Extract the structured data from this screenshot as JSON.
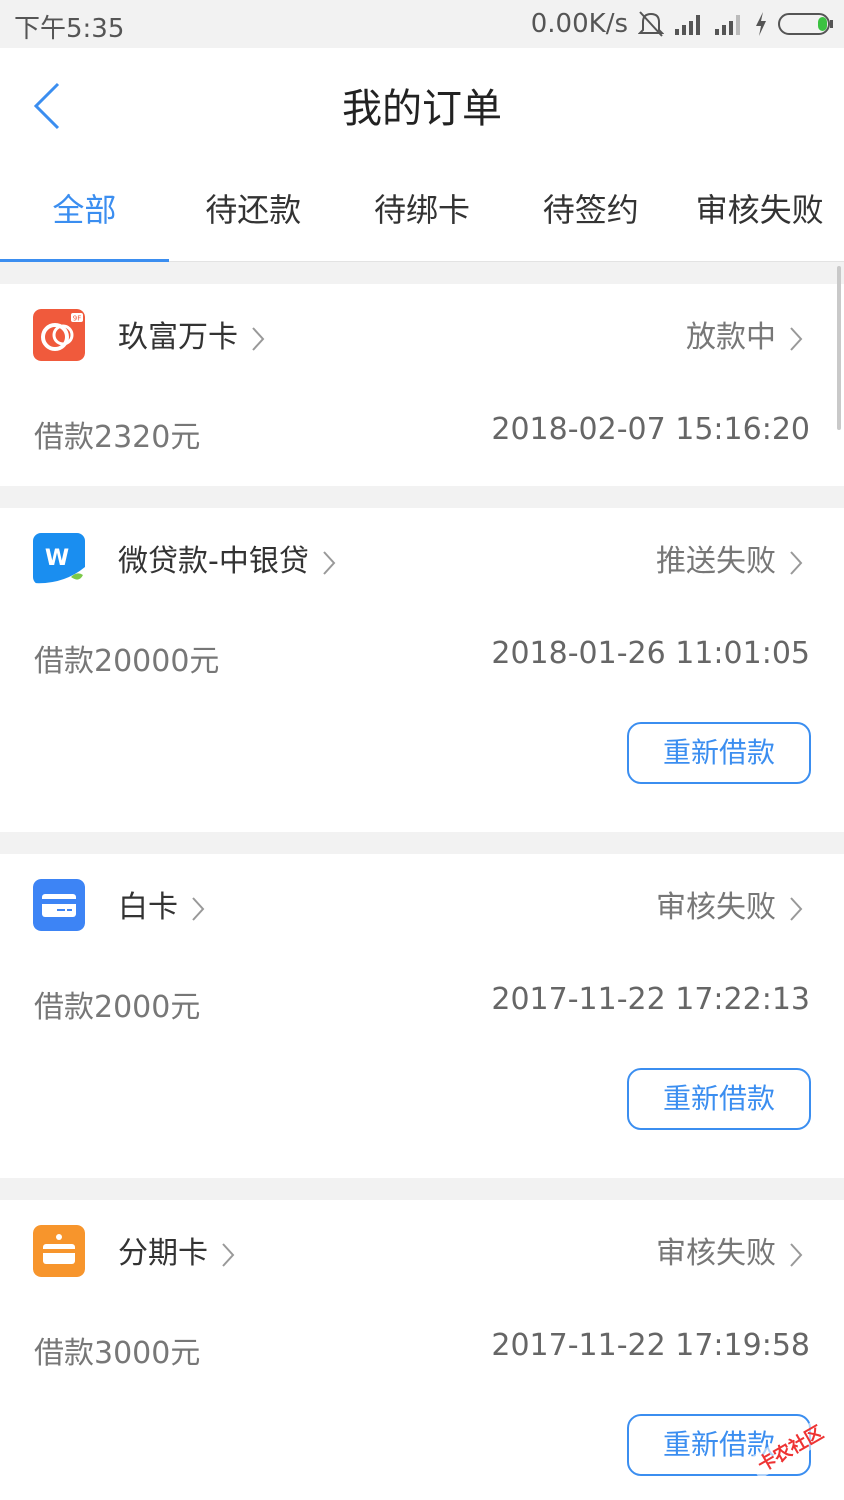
{
  "status_bar": {
    "time": "下午5:35",
    "net_speed": "0.00K/s"
  },
  "header": {
    "title": "我的订单",
    "back_icon": "chevron-left-icon"
  },
  "tabs": [
    {
      "label": "全部",
      "active": true
    },
    {
      "label": "待还款",
      "active": false
    },
    {
      "label": "待绑卡",
      "active": false
    },
    {
      "label": "待签约",
      "active": false
    },
    {
      "label": "审核失败",
      "active": false
    }
  ],
  "orders": [
    {
      "name": "玖富万卡",
      "status": "放款中",
      "amount": "借款2320元",
      "date": "2018-02-07 15:16:20",
      "logo_icon": "jiufu-logo-icon",
      "logo_color": "#f05a3c",
      "button": ""
    },
    {
      "name": "微贷款-中银贷",
      "status": "推送失败",
      "amount": "借款20000元",
      "date": "2018-01-26 11:01:05",
      "logo_icon": "weidai-logo-icon",
      "logo_color": "#1a8ef0",
      "button": "重新借款"
    },
    {
      "name": "白卡",
      "status": "审核失败",
      "amount": "借款2000元",
      "date": "2017-11-22 17:22:13",
      "logo_icon": "card-logo-icon",
      "logo_color": "#3d84f5",
      "button": "重新借款"
    },
    {
      "name": "分期卡",
      "status": "审核失败",
      "amount": "借款3000元",
      "date": "2017-11-22 17:19:58",
      "logo_icon": "installment-card-logo-icon",
      "logo_color": "#f7952c",
      "button": "重新借款"
    }
  ],
  "watermark": {
    "text": "卡农社区"
  },
  "colors": {
    "accent": "#3b8ef0",
    "background": "#f2f2f2"
  }
}
